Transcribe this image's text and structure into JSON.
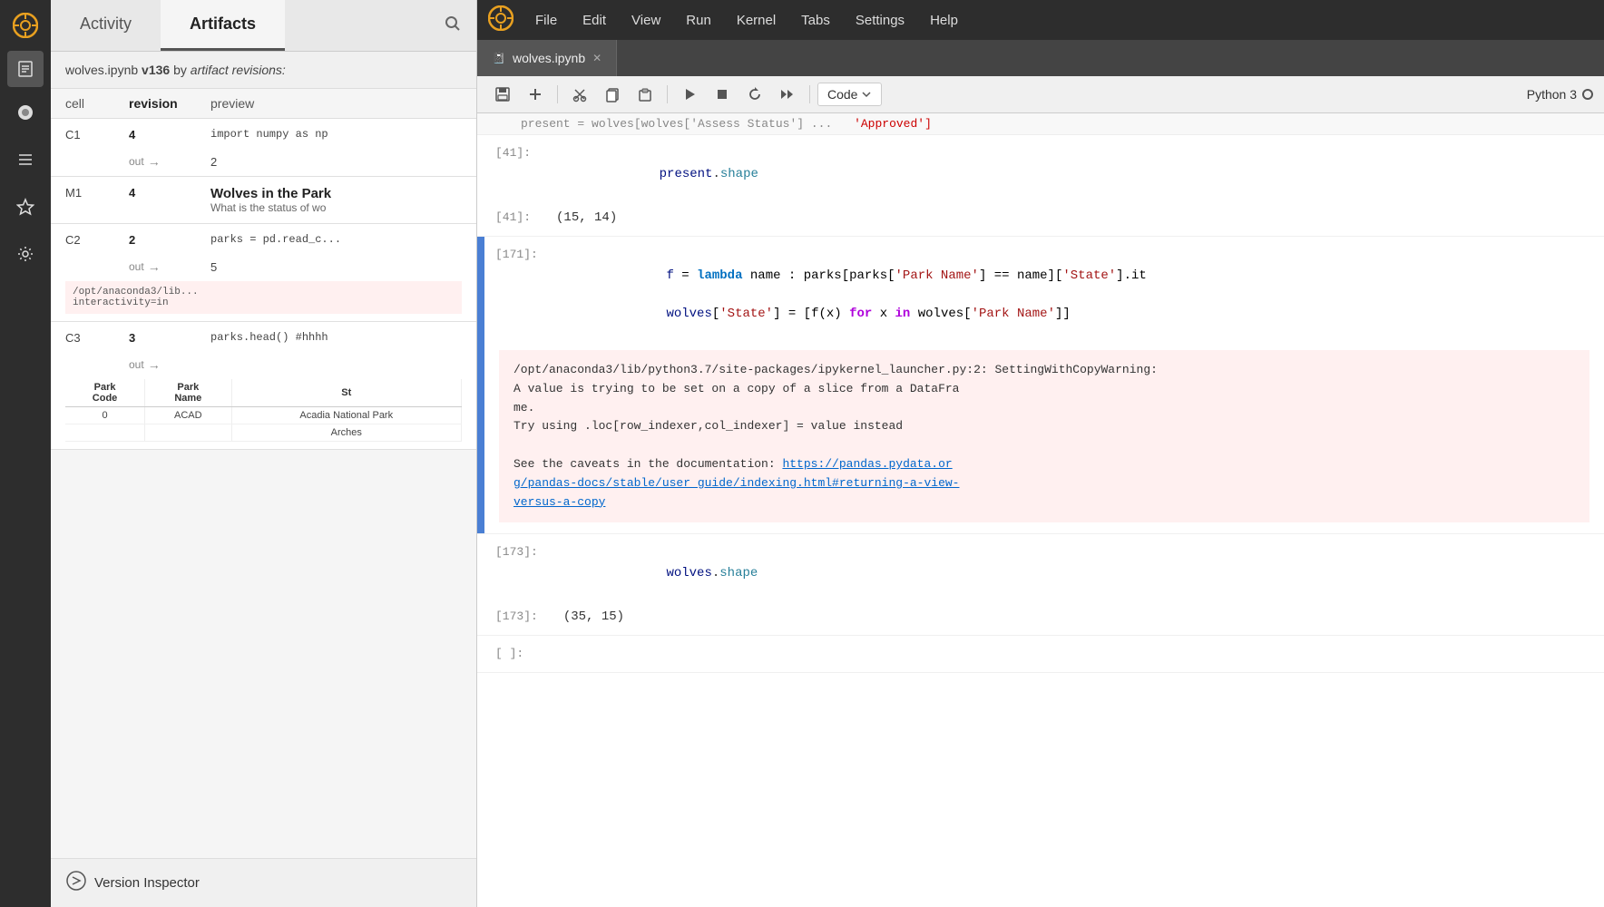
{
  "menu": {
    "items": [
      "File",
      "Edit",
      "View",
      "Run",
      "Kernel",
      "Tabs",
      "Settings",
      "Help"
    ]
  },
  "tabs": {
    "activity": "Activity",
    "artifacts": "Artifacts"
  },
  "search_icon": "🔍",
  "artifact_info": {
    "filename": "wolves.ipynb",
    "version_label": "v136",
    "by_text": "by",
    "suffix": "artifact revisions:"
  },
  "table_columns": {
    "cell": "cell",
    "revision": "revision",
    "preview": "preview"
  },
  "list_items": [
    {
      "id": "C1",
      "revision": "4",
      "preview": "import numpy as np",
      "out_label": "out",
      "out_value": "2"
    },
    {
      "id": "M1",
      "revision": "4",
      "title": "Wolves in the Park",
      "description": "What is the status of wo"
    },
    {
      "id": "C2",
      "revision": "2",
      "preview": "parks = pd.read_c...",
      "out_label": "out",
      "out_value": "5",
      "out_bg": "pink",
      "out_text": "/opt/anaconda3/lib... interactivity=in"
    },
    {
      "id": "C3",
      "revision": "3",
      "preview": "parks.head() #hhhh",
      "out_label": "out",
      "table": {
        "headers": [
          "Park Code",
          "Park Name",
          "St"
        ],
        "rows": [
          [
            "0",
            "ACAD",
            "Acadia National Park",
            ""
          ],
          [
            "",
            "",
            "Arches",
            ""
          ]
        ]
      }
    }
  ],
  "version_inspector": {
    "label": "Version Inspector"
  },
  "notebook_tab": {
    "icon": "📓",
    "name": "wolves.ipynb"
  },
  "toolbar": {
    "cell_type": "Code",
    "kernel": "Python 3"
  },
  "cells": [
    {
      "label_in": "[41]:",
      "label_out": "[41]:",
      "code": "present.shape",
      "code_parts": [
        {
          "text": "present",
          "class": "var"
        },
        {
          "text": ".",
          "class": "punc"
        },
        {
          "text": "shape",
          "class": "fn"
        }
      ],
      "output": "(15, 14)",
      "active": false
    },
    {
      "label_in": "[171]:",
      "label_out": "",
      "code_line1_parts": [
        {
          "text": "f",
          "class": "var"
        },
        {
          "text": " = ",
          "class": "punc"
        },
        {
          "text": "lambda",
          "class": "kw"
        },
        {
          "text": " name : parks[parks[",
          "class": "var"
        },
        {
          "text": "'Park Name'",
          "class": "str"
        },
        {
          "text": "] == name][",
          "class": "var"
        },
        {
          "text": "'State'",
          "class": "str"
        },
        {
          "text": "].it",
          "class": "var"
        }
      ],
      "code_line2_parts": [
        {
          "text": "wolves[",
          "class": "var"
        },
        {
          "text": "'State'",
          "class": "str"
        },
        {
          "text": "] = [f(x) ",
          "class": "var"
        },
        {
          "text": "for",
          "class": "kw-for"
        },
        {
          "text": " x ",
          "class": "var"
        },
        {
          "text": "in",
          "class": "kw-in"
        },
        {
          "text": " wolves[",
          "class": "var"
        },
        {
          "text": "'Park Name'",
          "class": "str"
        },
        {
          "text": "]]",
          "class": "var"
        }
      ],
      "warning": "/opt/anaconda3/lib/python3.7/site-packages/ipykernel_launcher.py:2: SettingWithCopyWarning:\nA value is trying to be set on a copy of a slice from a DataFrame.\n\nTry using .loc[row_indexer,col_indexer] = value instead\n\nSee the caveats in the documentation: ",
      "warning_link": "https://pandas.pydata.org/pandas-docs/stable/user_guide/indexing.html#returning-a-view-versus-a-copy",
      "active": true
    },
    {
      "label_in": "[173]:",
      "label_out": "[173]:",
      "code_parts": [
        {
          "text": "wolves",
          "class": "var"
        },
        {
          "text": ".",
          "class": "punc"
        },
        {
          "text": "shape",
          "class": "fn"
        }
      ],
      "output": "(35, 15)",
      "active": false
    },
    {
      "label_in": "[  ]:",
      "active": false
    }
  ]
}
